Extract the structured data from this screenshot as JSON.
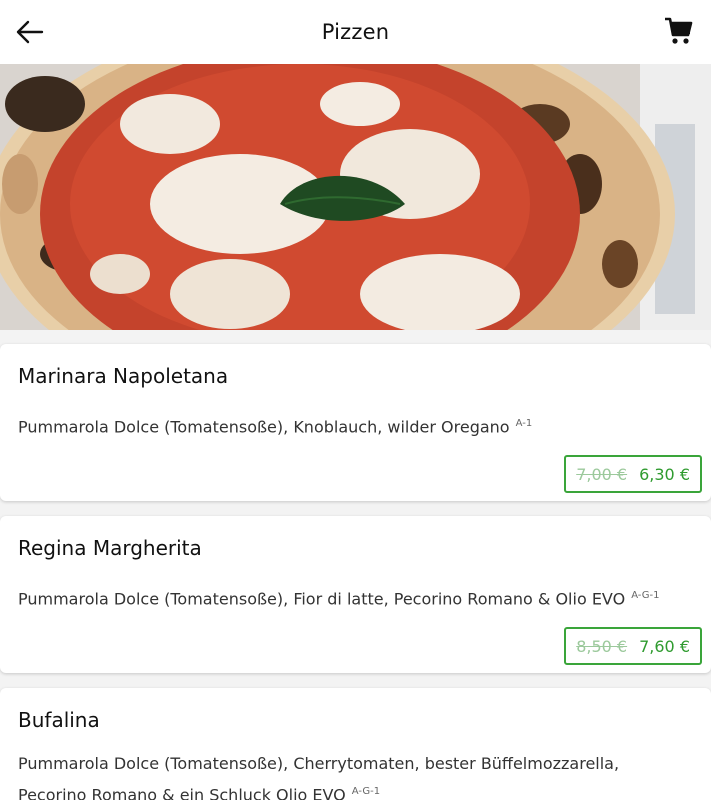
{
  "header": {
    "title": "Pizzen",
    "back_icon": "arrow-left-icon",
    "cart_icon": "cart-icon"
  },
  "hero": {
    "image": "pizza-margherita-photo"
  },
  "products": [
    {
      "name": "Marinara Napoletana",
      "description": "Pummarola Dolce (Tomatensoße), Knoblauch, wilder Oregano",
      "allergens": "A-1",
      "old_price": "7,00 €",
      "new_price": "6,30 €"
    },
    {
      "name": "Regina Margherita",
      "description": "Pummarola Dolce (Tomatensoße), Fior di latte, Pecorino Romano & Olio EVO",
      "allergens": "A-G-1",
      "old_price": "8,50 €",
      "new_price": "7,60 €"
    },
    {
      "name": "Bufalina",
      "description_line1": "Pummarola Dolce (Tomatensoße), Cherrytomaten, bester Büffelmozzarella,",
      "description_line2": "Pecorino Romano & ein Schluck Olio EVO",
      "allergens": "A-G-1"
    }
  ],
  "colors": {
    "accent_green": "#2f9b2f",
    "old_price_green": "#9cc99c",
    "card_bg": "#ffffff",
    "page_bg": "#f3f3f3"
  }
}
